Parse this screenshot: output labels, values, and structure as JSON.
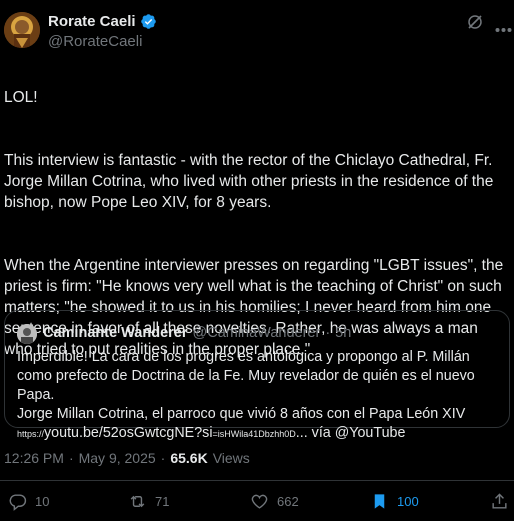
{
  "author": {
    "display_name": "Rorate Caeli",
    "handle": "@RorateCaeli",
    "verified_color": "#1d9bf0"
  },
  "tweet": {
    "paragraphs": [
      "LOL!",
      "This interview is fantastic - with the rector of the Chiclayo Cathedral, Fr. Jorge Millan Cotrina, who lived with other priests in the residence of the bishop, now Pope Leo XIV, for 8 years.",
      "When the Argentine interviewer presses on regarding \"LGBT issues\", the priest is firm: \"He knows very well what is the teaching of Christ\" on such matters; \"he showed it to us in his homilies; I never heard from him one sentence in favor of all these novelties. Rather, he was always a man who tried to put realities in the proper place.\""
    ]
  },
  "quote": {
    "display_name": "Caminante Wanderer",
    "handle": "@CaminaWanderer",
    "dot": "·",
    "time": "5h",
    "text": "Imperdible! La cara de los progres es antológica y propongo al P. Millán como prefecto de Doctrina de la Fe. Muy revelador de quién es el nuevo Papa.",
    "line2": "Jorge Millan Cotrina, el parroco que vivió 8 años con el Papa León XIV",
    "link_prefix": "https://",
    "link_main": "youtu.be/52osGwtcgNE?si",
    "link_tail": "=isHWila41Dbzhh0D",
    "link_suffix": "... vía @YouTube"
  },
  "meta": {
    "time": "12:26 PM",
    "sep1": "·",
    "date": "May 9, 2025",
    "sep2": "·",
    "views_count": "65.6K",
    "views_label": "Views"
  },
  "actions": {
    "replies": "10",
    "reposts": "71",
    "likes": "662",
    "bookmarks": "100"
  },
  "colors": {
    "background": "#000000",
    "text": "#e7e9ea",
    "muted": "#71767b",
    "accent": "#1d9bf0",
    "border": "#2f3336"
  }
}
